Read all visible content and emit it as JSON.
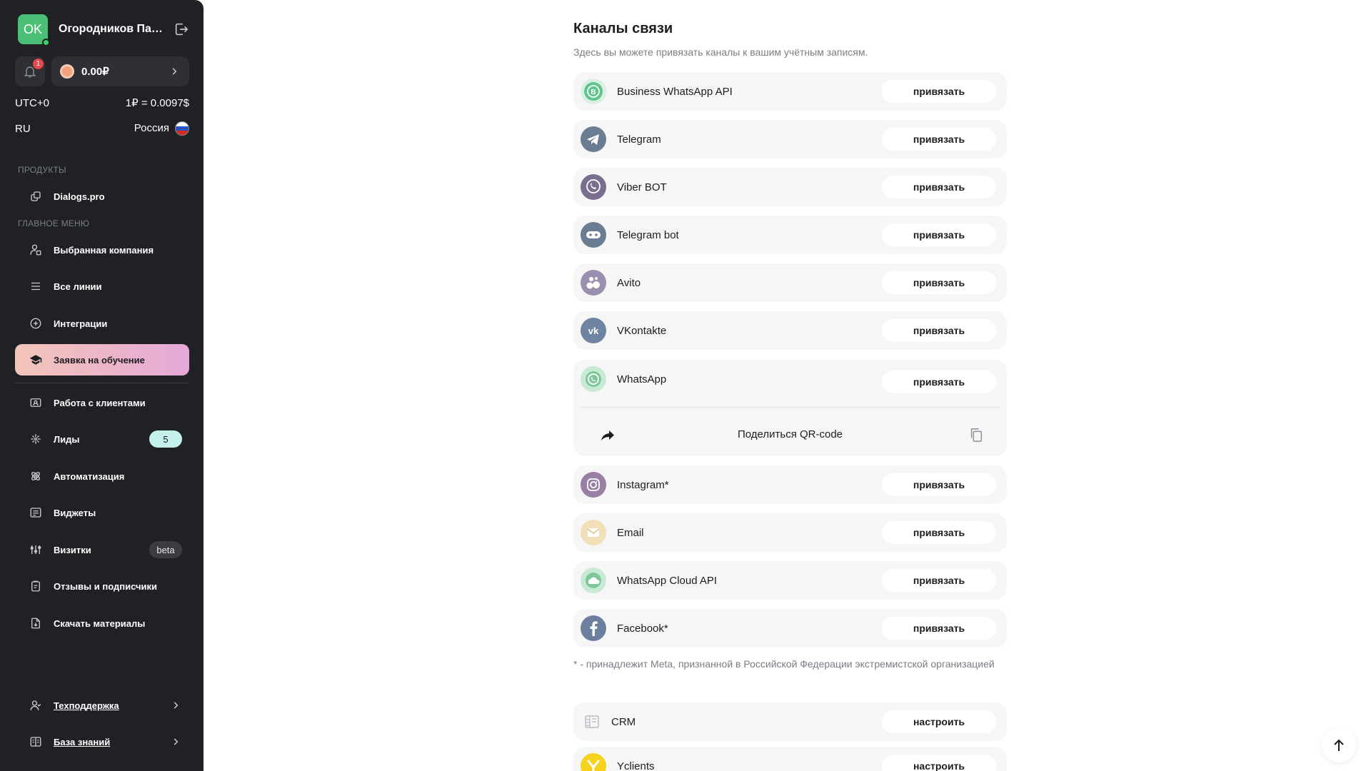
{
  "sidebar": {
    "profile": {
      "initials": "OK",
      "name": "Огородников Пав..."
    },
    "balance": "0.00₽",
    "notifications_count": "1",
    "timezone": "UTC+0",
    "rate": "1₽ = 0.0097$",
    "language": "RU",
    "country": "Россия",
    "products_title": "ПРОДУКТЫ",
    "products": [
      {
        "label": "Dialogs.pro",
        "icon": "link-icon"
      }
    ],
    "main_menu_title": "ГЛАВНОЕ МЕНЮ",
    "menu": [
      {
        "label": "Выбранная компания",
        "icon": "user-company-icon"
      },
      {
        "label": "Все линии",
        "icon": "list-icon"
      },
      {
        "label": "Интеграции",
        "icon": "plus-circle-icon"
      },
      {
        "label": "Заявка на обучение",
        "icon": "graduation-cap-icon",
        "active": true
      },
      {
        "label": "Работа с клиентами",
        "icon": "contact-card-icon"
      },
      {
        "label": "Лиды",
        "icon": "leads-icon",
        "badge": "5"
      },
      {
        "label": "Автоматизация",
        "icon": "automation-icon"
      },
      {
        "label": "Виджеты",
        "icon": "widget-icon"
      },
      {
        "label": "Визитки",
        "icon": "sliders-icon",
        "badge": "beta"
      },
      {
        "label": "Отзывы и подписчики",
        "icon": "clipboard-icon"
      },
      {
        "label": "Скачать материалы",
        "icon": "download-file-icon"
      }
    ],
    "support": "Техподдержка",
    "knowledge_base": "База знаний"
  },
  "main": {
    "title": "Каналы связи",
    "subtitle": "Здесь вы можете привязать каналы к вашим учётным записям.",
    "bind_label": "привязать",
    "configure_label": "настроить",
    "channels": [
      {
        "name": "Business WhatsApp API",
        "icon": "business-whatsapp-icon",
        "color": "#5fc68a"
      },
      {
        "name": "Telegram",
        "icon": "telegram-icon",
        "color": "#6b7d93"
      },
      {
        "name": "Viber BOT",
        "icon": "viber-icon",
        "color": "#7b6e8f"
      },
      {
        "name": "Telegram bot",
        "icon": "telegram-bot-icon",
        "color": "#6b7d93"
      },
      {
        "name": "Avito",
        "icon": "avito-icon",
        "color": "#9b8fb0"
      },
      {
        "name": "VKontakte",
        "icon": "vk-icon",
        "color": "#6f83a3"
      },
      {
        "name": "WhatsApp",
        "icon": "whatsapp-icon",
        "color": "#7fc79a"
      },
      {
        "name": "Instagram*",
        "icon": "instagram-icon",
        "color": "#9a7fa4"
      },
      {
        "name": "Email",
        "icon": "email-icon",
        "color": "#e2c48a"
      },
      {
        "name": "WhatsApp Cloud API",
        "icon": "whatsapp-cloud-icon",
        "color": "#7fc79a"
      },
      {
        "name": "Facebook*",
        "icon": "facebook-icon",
        "color": "#6d7f9e"
      }
    ],
    "qr_share": "Поделиться QR-code",
    "meta_note": "* - принадлежит Meta, признанной в Российской Федерации экстремистской организацией",
    "integrations": [
      {
        "name": "CRM",
        "icon": "crm-icon"
      },
      {
        "name": "Yclients",
        "icon": "yclients-icon",
        "color": "#f5d21e"
      }
    ]
  }
}
